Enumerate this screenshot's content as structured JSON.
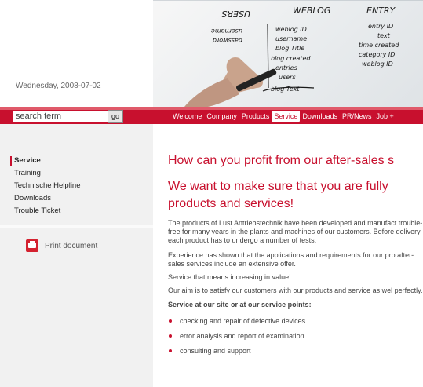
{
  "header": {
    "date": "Wednesday, 2008-07-02"
  },
  "search": {
    "placeholder": "search term",
    "go_label": "go"
  },
  "nav": {
    "items": [
      "Welcome",
      "Company",
      "Products",
      "Service",
      "Downloads",
      "PR/News",
      "Job +"
    ],
    "active": "Service"
  },
  "sidebar": {
    "items": [
      {
        "label": "Service",
        "active": true
      },
      {
        "label": "Training"
      },
      {
        "label": "Technische Helpline"
      },
      {
        "label": "Downloads"
      },
      {
        "label": "Trouble Ticket"
      }
    ],
    "print_label": "Print document"
  },
  "content": {
    "heading1": "How can you profit from our after-sales s",
    "heading2": "We want to make sure that you are fully products and services!",
    "para1": "The products of Lust Antriebstechnik have been developed and manufact trouble-free for many years in the plants and machines of our customers. Before delivery each product has to undergo a number of tests.",
    "para2": "Experience has shown that the applications and requirements for our pro after-sales services include an extensive offer.",
    "para3": "Service that means increasing in value!",
    "para4": "Our aim is to satisfy our customers with our products and service as wel perfectly.",
    "subheading": "Service at our site or at our service points:",
    "bullets": [
      "checking and repair of defective devices",
      "error analysis and report of examination",
      "consulting and support"
    ]
  },
  "hero": {
    "col_left_heading": "USERS",
    "col_mid_heading": "WEBLOG",
    "col_right_heading": "ENTRY",
    "col_left": [
      "username",
      "password"
    ],
    "col_mid": [
      "weblog ID",
      "username",
      "blog Title",
      "blog created",
      "entries",
      "users",
      "blog Text"
    ],
    "col_right": [
      "entry ID",
      "text",
      "time created",
      "category ID",
      "weblog ID"
    ]
  },
  "colors": {
    "brand_red": "#c8102e"
  }
}
